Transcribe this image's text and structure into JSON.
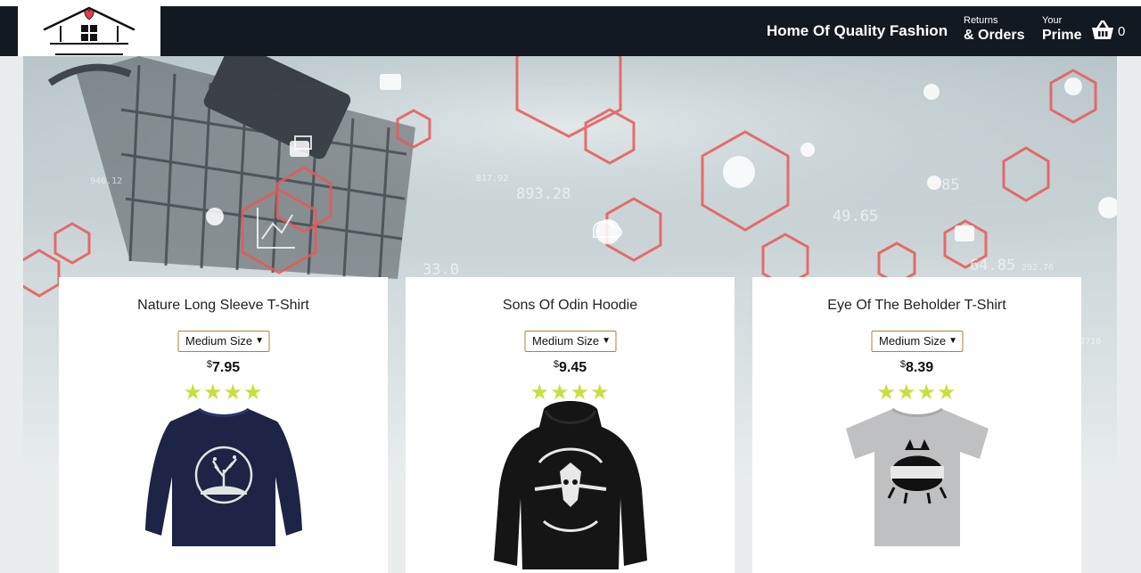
{
  "header": {
    "brand": "Home Of Quality Fashion",
    "returns_line1": "Returns",
    "returns_line2": "& Orders",
    "prime_line1": "Your",
    "prime_line2": "Prime",
    "basket_count": "0"
  },
  "hero": {
    "numbers": [
      "893.28",
      "49.65",
      "85",
      "64.85",
      "292.76",
      "817.92",
      "33.0",
      "2710",
      "946.12"
    ]
  },
  "products": [
    {
      "title": "Nature Long Sleeve T-Shirt",
      "size": "Medium Size",
      "currency": "$",
      "price": "7.95",
      "stars": "★★★★",
      "rating": 4
    },
    {
      "title": "Sons Of Odin Hoodie",
      "size": "Medium Size",
      "currency": "$",
      "price": "9.45",
      "stars": "★★★★",
      "rating": 4
    },
    {
      "title": "Eye Of The Beholder T-Shirt",
      "size": "Medium Size",
      "currency": "$",
      "price": "8.39",
      "stars": "★★★★",
      "rating": 4
    }
  ],
  "colors": {
    "header_bg": "#131921",
    "star": "#c8df3d",
    "hex_accent": "#e8585a"
  }
}
